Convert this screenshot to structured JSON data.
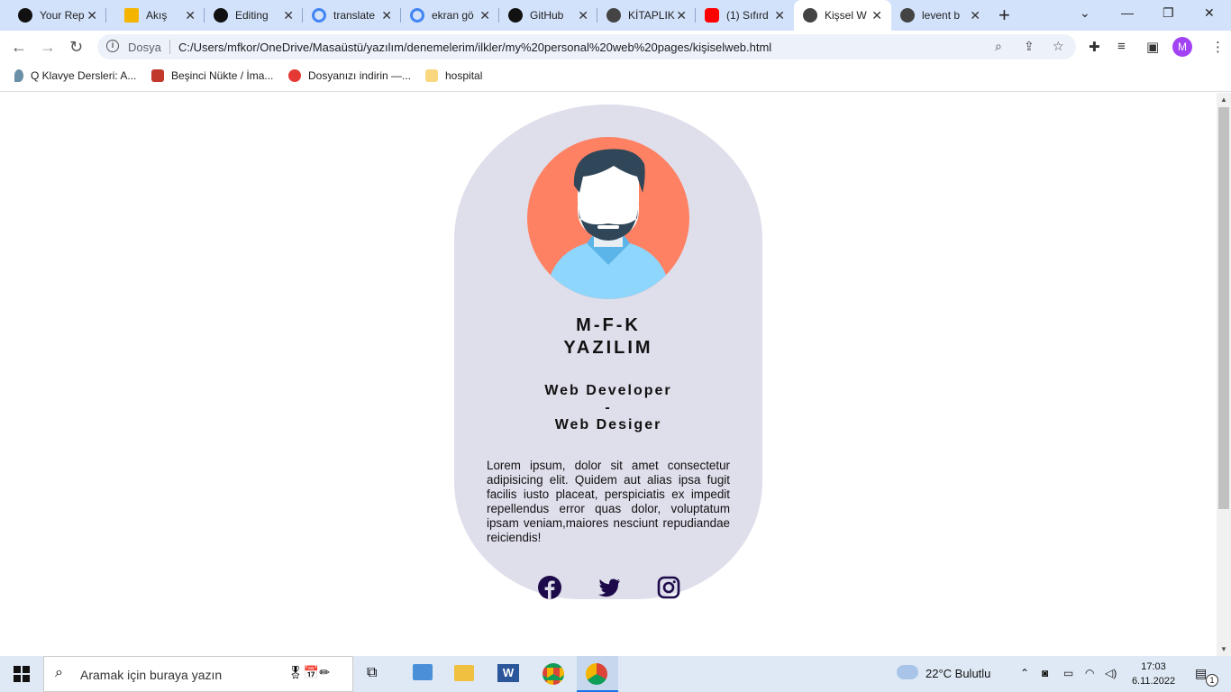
{
  "browser": {
    "tabs": [
      {
        "label": "Your Rep",
        "icon": "github-icon"
      },
      {
        "label": "Akış",
        "icon": "classroom-icon"
      },
      {
        "label": "Editing",
        "icon": "github-icon"
      },
      {
        "label": "translate",
        "icon": "google-icon"
      },
      {
        "label": "ekran gö",
        "icon": "google-icon"
      },
      {
        "label": "GitHub",
        "icon": "github-icon"
      },
      {
        "label": "KİTAPLIK",
        "icon": "globe-icon"
      },
      {
        "label": "(1) Sıfırd",
        "icon": "youtube-icon"
      },
      {
        "label": "Kişsel W",
        "icon": "globe-icon",
        "active": true
      },
      {
        "label": "levent b",
        "icon": "globe-icon"
      }
    ],
    "address": {
      "scheme_label": "Dosya",
      "url": "C:/Users/mfkor/OneDrive/Masaüstü/yazılım/denemelerim/ilkler/my%20personal%20web%20pages/kişiselweb.html"
    },
    "profile_initial": "M",
    "bookmarks": [
      {
        "label": "Q Klavye Dersleri: A..."
      },
      {
        "label": "Beşinci Nükte / İma..."
      },
      {
        "label": "Dosyanızı indirin —..."
      },
      {
        "label": "hospital"
      }
    ]
  },
  "page": {
    "name_line1": "M-F-K",
    "name_line2": "YAZILIM",
    "role_line1": "Web Developer",
    "role_line2": "-",
    "role_line3": "Web Desiger",
    "about": "Lorem ipsum, dolor sit amet consectetur adipisicing elit. Quidem aut alias ipsa fugit facilis iusto placeat, perspiciatis ex impedit repellendus error quas dolor, voluptatum ipsam veniam,maiores nesciunt repudiandae reiciendis!",
    "social": [
      "facebook-icon",
      "twitter-icon",
      "instagram-icon"
    ],
    "colors": {
      "card": "#dfdeeb",
      "avatar_bg": "#fe8163",
      "social": "#1d0a4a"
    }
  },
  "taskbar": {
    "search_placeholder": "Aramak için buraya yazın",
    "weather": "22°C  Bulutlu",
    "time": "17:03",
    "date": "6.11.2022",
    "notification_count": "1"
  }
}
